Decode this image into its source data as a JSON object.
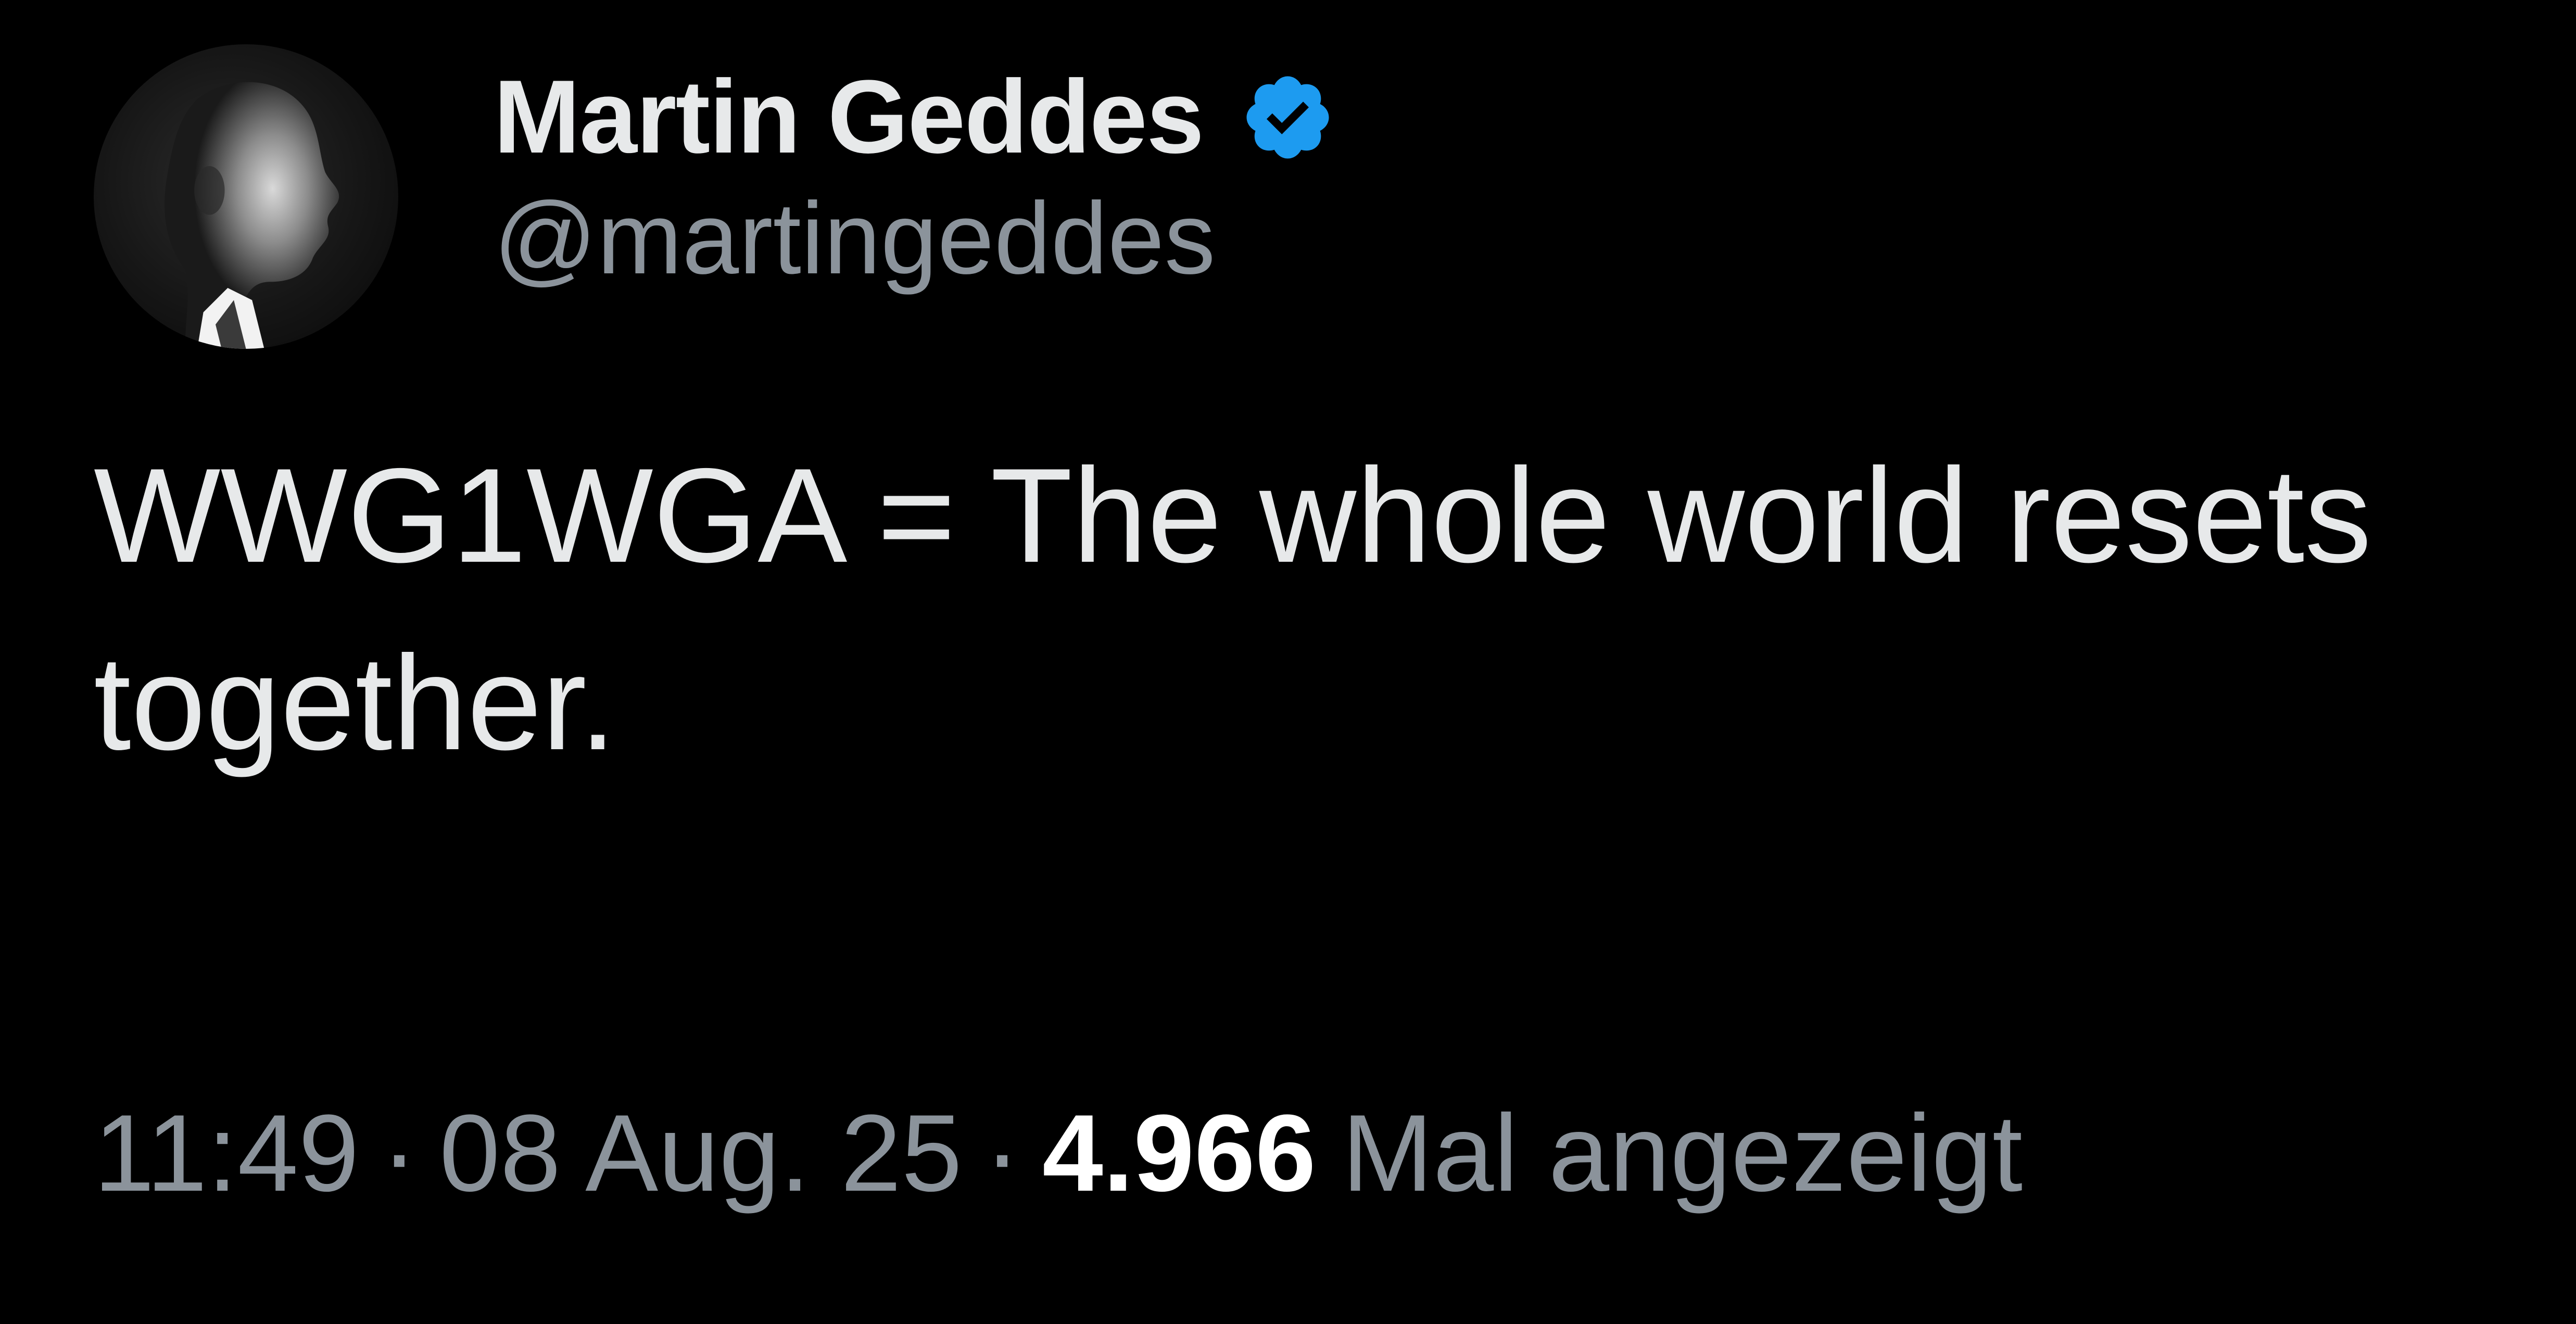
{
  "tweet": {
    "author": {
      "display_name": "Martin Geddes",
      "handle": "@martingeddes",
      "verified": true,
      "verified_color": "#1d9bf0"
    },
    "text": "WWG1WGA = The whole world resets together.",
    "meta": {
      "time": "11:49",
      "separator": "·",
      "date": "08 Aug. 25",
      "views_count": "4.966",
      "views_label": "Mal angezeigt"
    }
  },
  "colors": {
    "background": "#000000",
    "primary_text": "#e7e9ea",
    "secondary_text": "#8b939b",
    "emphasis_text": "#ffffff",
    "accent": "#1d9bf0"
  },
  "icons": {
    "verified": "verified-badge-icon",
    "avatar": "profile-avatar"
  }
}
